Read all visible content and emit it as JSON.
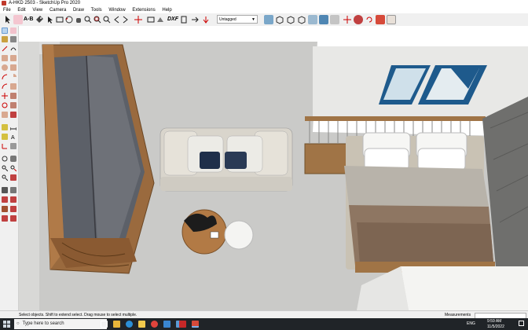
{
  "window": {
    "title": "A-HKD 2503 - SketchUp Pro 2020"
  },
  "menu": [
    "File",
    "Edit",
    "View",
    "Camera",
    "Draw",
    "Tools",
    "Window",
    "Extensions",
    "Help"
  ],
  "toolbar": {
    "ab_label": "A-B",
    "dxf_label": "DXF",
    "tag_selected": "Untagged",
    "icons": [
      "eraser-icon",
      "select-icon",
      "tape-icon",
      "orbit-icon",
      "pan-icon",
      "zoom-icon",
      "move-icon",
      "rotate-icon",
      "section-icon",
      "component-icon",
      "paint-icon",
      "arrow-icon",
      "scene-icon"
    ]
  },
  "left_tools": [
    "select-icon",
    "eraser-icon",
    "paint-icon",
    "line-icon",
    "arc-icon",
    "rectangle-icon",
    "circle-icon",
    "polygon-icon",
    "pushpull-icon",
    "move-icon",
    "rotate-icon",
    "scale-icon",
    "offset-icon",
    "followme-icon",
    "tape-icon",
    "protractor-icon",
    "dimension-icon",
    "text-icon",
    "axes-icon",
    "3dtext-icon",
    "orbit-icon",
    "pan-icon",
    "zoom-icon",
    "zoom-window-icon",
    "zoom-extents-icon",
    "walk-icon",
    "lookaround-icon",
    "section-icon"
  ],
  "statusbar": {
    "hint": "Select objects. Shift to extend select. Drag mouse to select multiple.",
    "measurements_label": "Measurements"
  },
  "taskbar": {
    "search_placeholder": "Type here to search",
    "time": "9:59 AM",
    "date": "11/5/2022",
    "lang": "ENG"
  },
  "colors": {
    "floor": "#c9c9c7",
    "wall": "#e9e9e7",
    "wood": "#9a6a3e",
    "accent_blue": "#1e5a8c",
    "taskbar": "#202428"
  }
}
